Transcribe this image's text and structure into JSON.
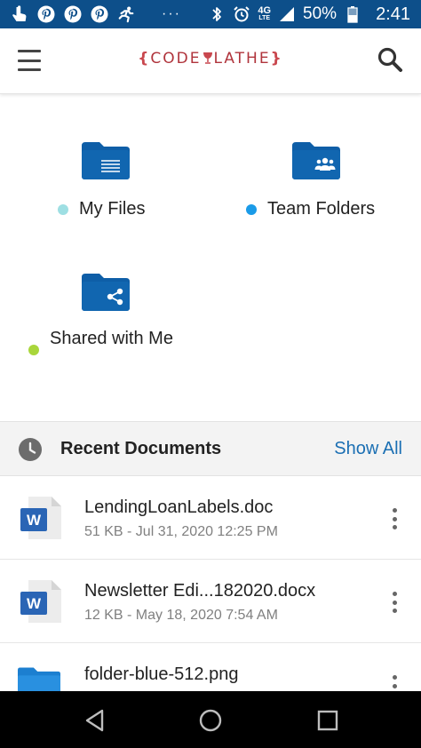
{
  "status_bar": {
    "left_icons": [
      "touch-icon",
      "pinterest-icon",
      "pinterest-icon",
      "pinterest-icon",
      "running-icon"
    ],
    "dots": "···",
    "network": "4G",
    "network_sub": "LTE",
    "battery": "50%",
    "time": "2:41"
  },
  "app_bar": {
    "logo_left_brace": "{",
    "logo_text_1": "CODE",
    "logo_text_2": "LATHE",
    "logo_right_brace": "}"
  },
  "folders": [
    {
      "label": "My Files",
      "dot_color": "#9edfe3",
      "icon": "folder-files-icon"
    },
    {
      "label": "Team Folders",
      "dot_color": "#1a9be8",
      "icon": "folder-team-icon"
    },
    {
      "label": "Shared with Me",
      "dot_color": "#a9d63b",
      "icon": "folder-share-icon"
    }
  ],
  "recent": {
    "title": "Recent Documents",
    "show_all": "Show All"
  },
  "documents": [
    {
      "name": "LendingLoanLabels.doc",
      "meta": "51 KB - Jul 31, 2020 12:25 PM",
      "type": "word"
    },
    {
      "name": "Newsletter Edi...182020.docx",
      "meta": "12 KB - May 18, 2020 7:54 AM",
      "type": "word"
    },
    {
      "name": "folder-blue-512.png",
      "meta": "",
      "type": "image"
    }
  ],
  "colors": {
    "status_bar": "#0d4f8a",
    "folder_blue": "#0e5ea7",
    "brand_red": "#b0343c",
    "link_blue": "#1b6fb3",
    "word_blue": "#2a65b5"
  }
}
